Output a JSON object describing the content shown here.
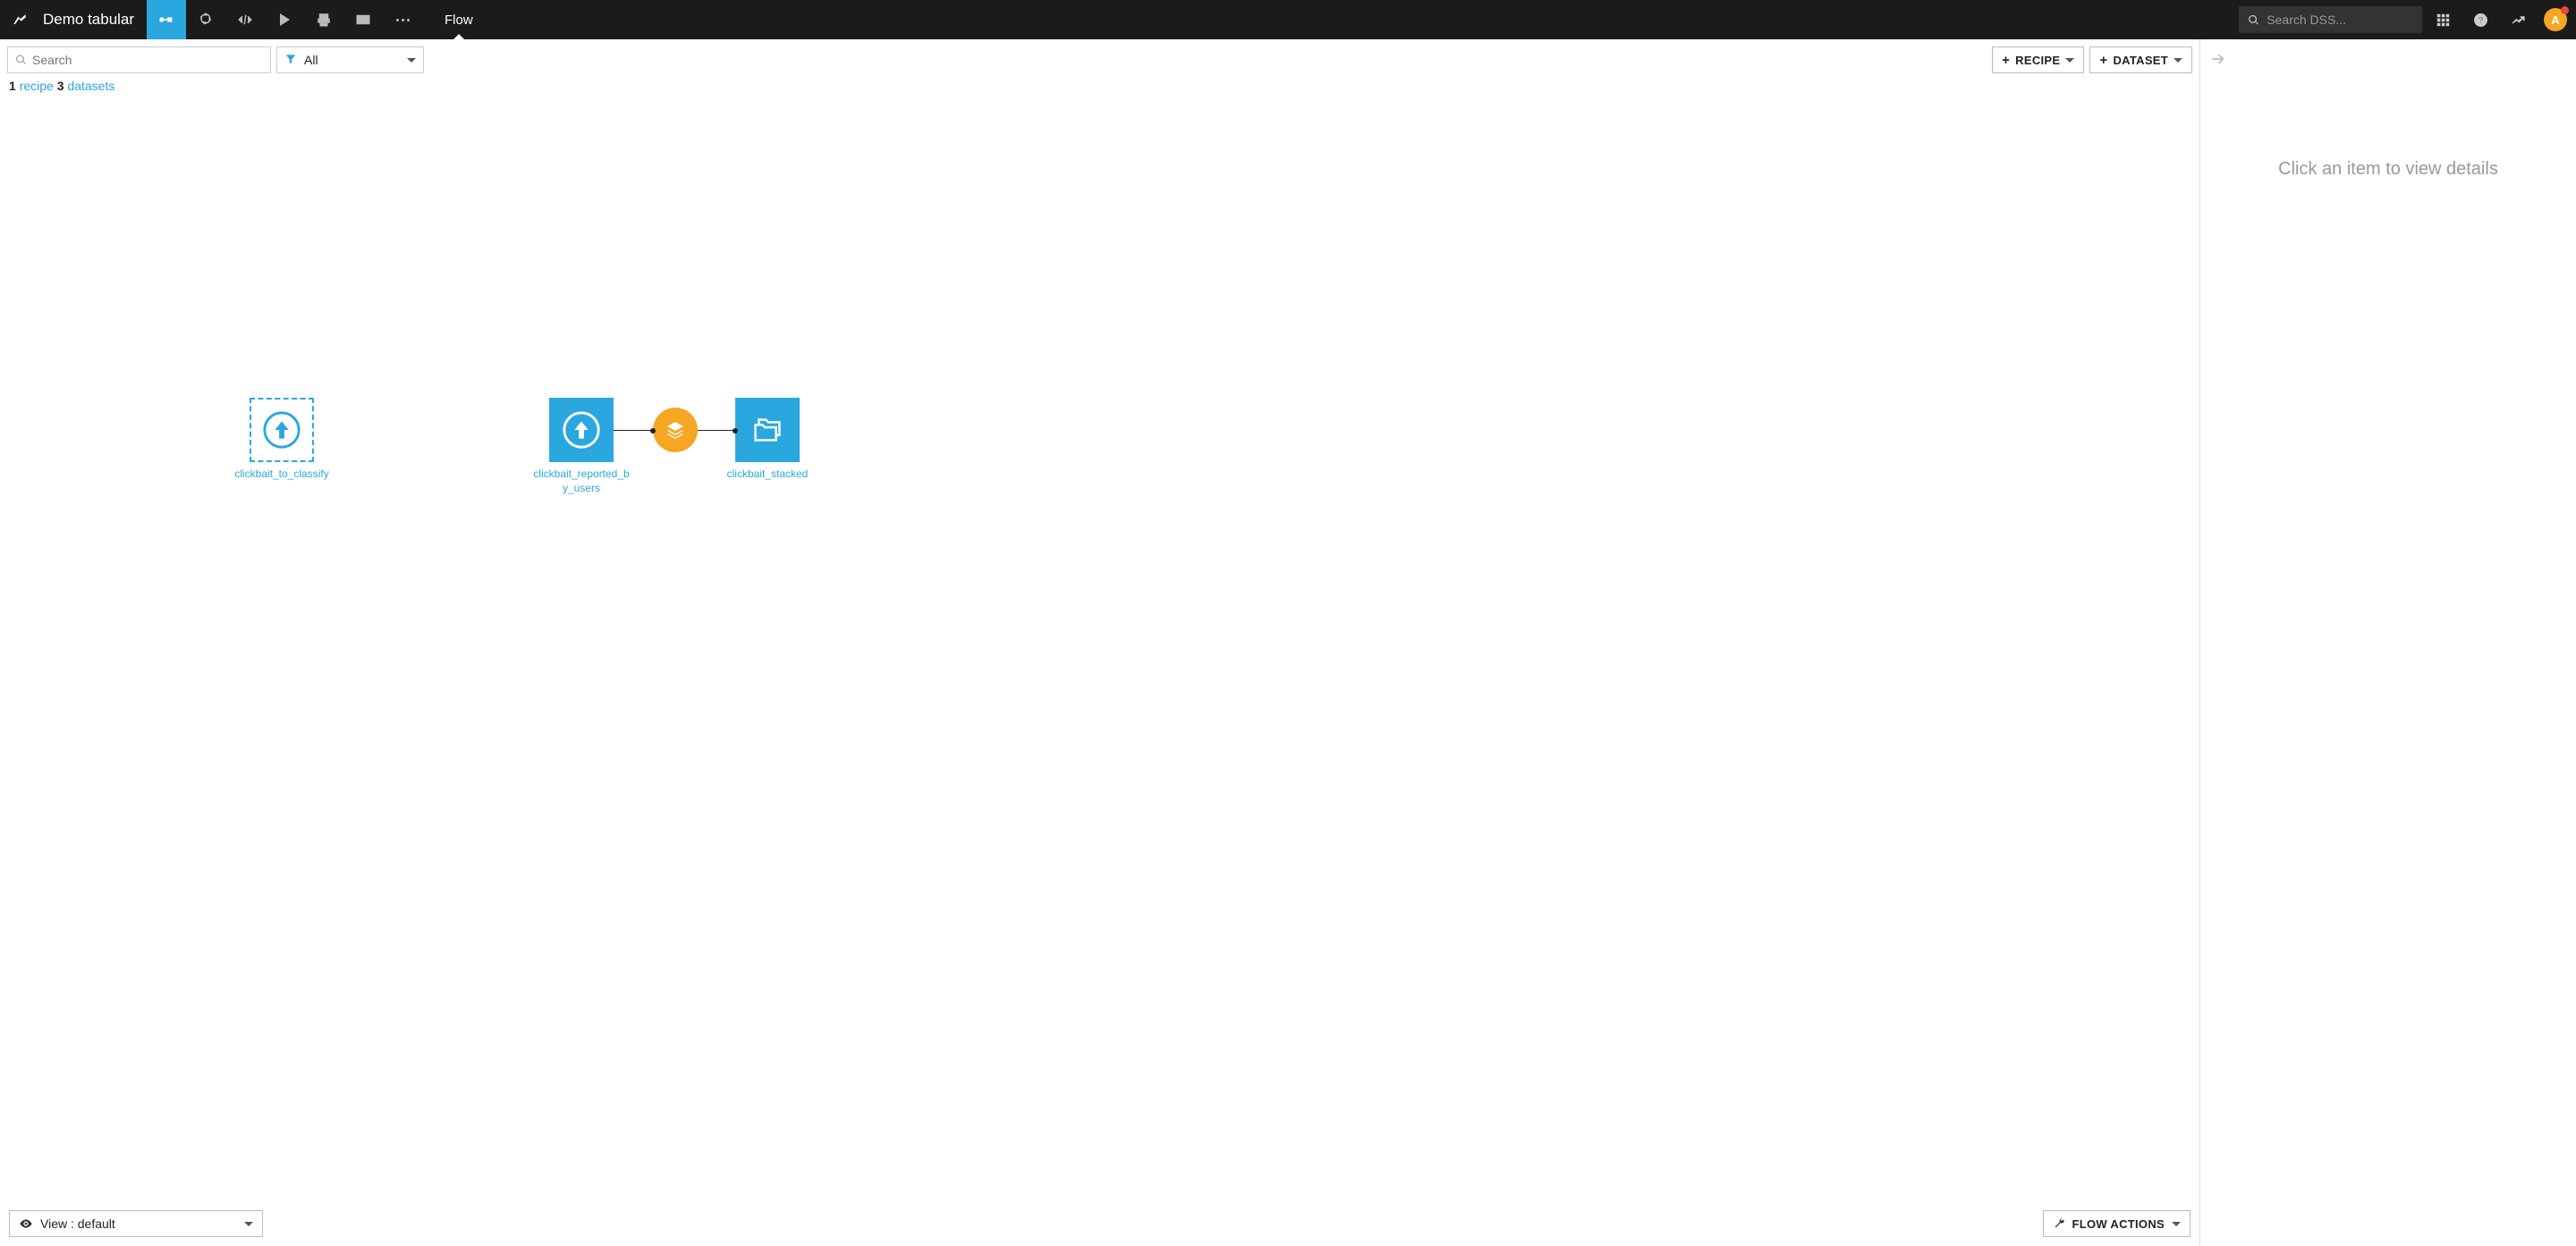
{
  "project_title": "Demo tabular",
  "page_label": "Flow",
  "global_search_placeholder": "Search DSS...",
  "avatar_letter": "A",
  "search_placeholder": "Search",
  "filter_label": "All",
  "summary": {
    "recipe_count": "1",
    "recipe_word": "recipe",
    "dataset_count": "3",
    "dataset_word": "datasets"
  },
  "add_recipe_label": "RECIPE",
  "add_dataset_label": "DATASET",
  "nodes": {
    "n1": {
      "label": "clickbait_to_classify"
    },
    "n2": {
      "label": "clickbait_reported_by_users"
    },
    "n3": {
      "label": "clickbait_stacked"
    }
  },
  "view_label": "View : default",
  "flow_actions_label": "FLOW ACTIONS",
  "details_empty_text": "Click an item to view details"
}
